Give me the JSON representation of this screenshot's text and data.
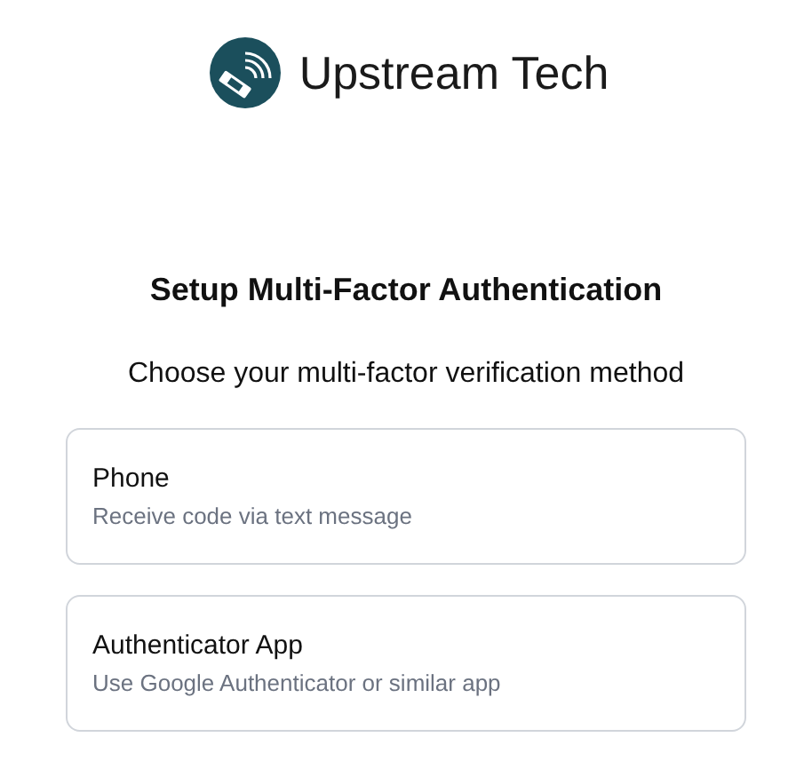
{
  "brand": {
    "name": "Upstream Tech"
  },
  "heading": "Setup Multi-Factor Authentication",
  "subtitle": "Choose your multi-factor verification method",
  "methods": [
    {
      "title": "Phone",
      "description": "Receive code via text message"
    },
    {
      "title": "Authenticator App",
      "description": "Use Google Authenticator or similar app"
    }
  ]
}
